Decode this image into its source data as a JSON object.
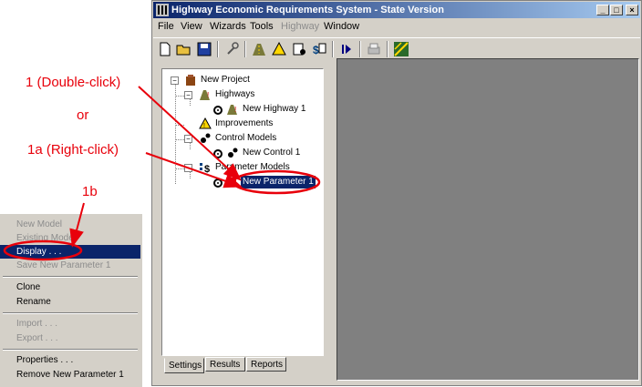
{
  "window": {
    "title": "Highway Economic Requirements System - State Version",
    "controls": [
      "_",
      "□",
      "×"
    ]
  },
  "menubar": {
    "items": [
      {
        "label": "File",
        "enabled": true
      },
      {
        "label": "View",
        "enabled": true
      },
      {
        "label": "Wizards",
        "enabled": true
      },
      {
        "label": "Tools",
        "enabled": true
      },
      {
        "label": "Highway",
        "enabled": false
      },
      {
        "label": "Window",
        "enabled": true
      }
    ]
  },
  "toolbar": {
    "icons": [
      "new-icon",
      "open-folder-icon",
      "save-icon",
      "wrench-icon",
      "highway-icon",
      "improvements-icon",
      "control-models-icon",
      "parameter-models-icon",
      "run-icon",
      "print-icon",
      "map-icon"
    ]
  },
  "tree": {
    "root": "New Project",
    "highways": "Highways",
    "new_highway": "New Highway 1",
    "improvements": "Improvements",
    "control_models": "Control Models",
    "new_control": "New Control 1",
    "parameter_models": "Parameter Models",
    "new_parameter": "New Parameter 1"
  },
  "tabs": [
    "Settings",
    "Results",
    "Reports"
  ],
  "annotations": {
    "double_click": "1 (Double-click)",
    "or": "or",
    "right_click": "1a (Right-click)",
    "step_1b": "1b"
  },
  "context_menu": {
    "new_model": "New Model",
    "existing_model": "Existing Model",
    "display": "Display . . .",
    "save": "Save New Parameter 1",
    "clone": "Clone",
    "rename": "Rename",
    "import": "Import . . .",
    "export": "Export . . .",
    "properties": "Properties . . .",
    "remove": "Remove New Parameter 1"
  },
  "colors": {
    "annotation_red": "#e8000b",
    "title_blue": "#0a246a",
    "selection_blue": "#0a246a"
  }
}
